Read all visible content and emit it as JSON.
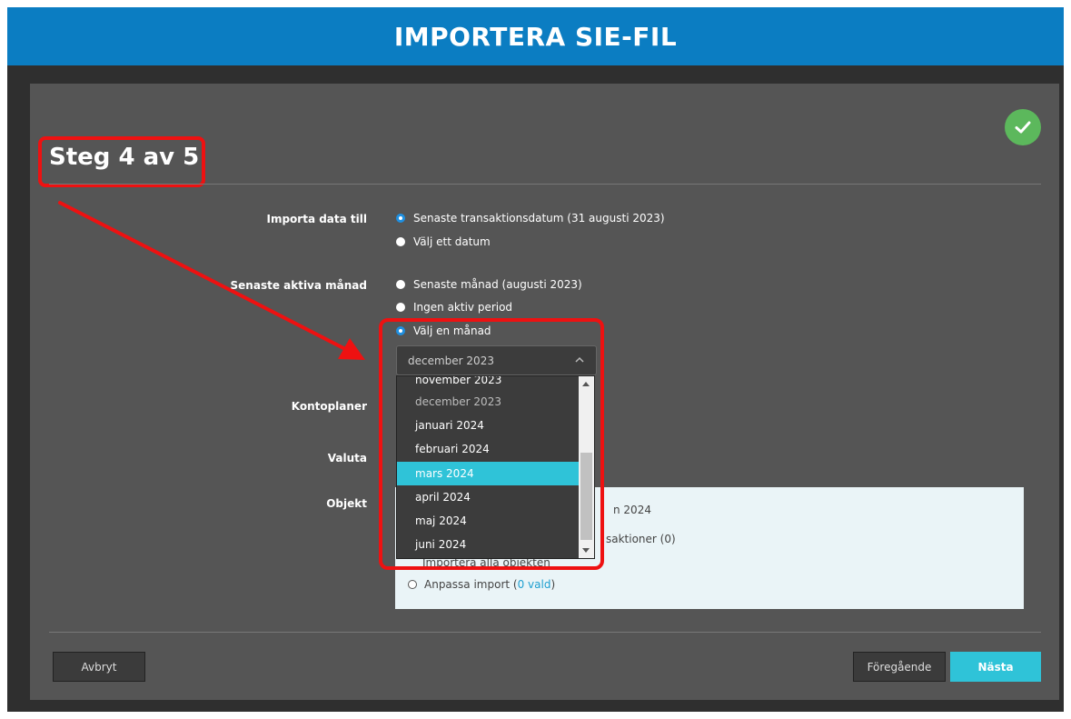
{
  "header": {
    "title": "IMPORTERA SIE-FIL"
  },
  "step": {
    "title": "Steg 4 av 5"
  },
  "import_to": {
    "label": "Importa data till",
    "options": [
      "Senaste transaktionsdatum (31 augusti 2023)",
      "Välj ett datum"
    ]
  },
  "active_month": {
    "label": "Senaste aktiva månad",
    "options": [
      "Senaste månad (augusti 2023)",
      "Ingen aktiv period",
      "Välj en månad"
    ]
  },
  "month_select": {
    "value": "december 2023",
    "options": [
      "november 2023",
      "december 2023",
      "januari 2024",
      "februari 2024",
      "mars 2024",
      "april 2024",
      "maj 2024",
      "juni 2024"
    ]
  },
  "labels": {
    "kontoplaner": "Kontoplaner",
    "valuta": "Valuta",
    "objekt": "Objekt"
  },
  "objekt_box": {
    "partial_1": "n 2024",
    "partial_2": "saktioner (0)",
    "partial_3": "Importera alla objekten",
    "custom_label": "Anpassa import (",
    "custom_link": "0 vald",
    "custom_close": ")"
  },
  "buttons": {
    "cancel": "Avbryt",
    "previous": "Föregående",
    "next": "Nästa"
  },
  "colors": {
    "header": "#0b7dc2",
    "accent": "#2fc3d8",
    "highlight": "#ee1111",
    "success": "#5cb85c"
  }
}
